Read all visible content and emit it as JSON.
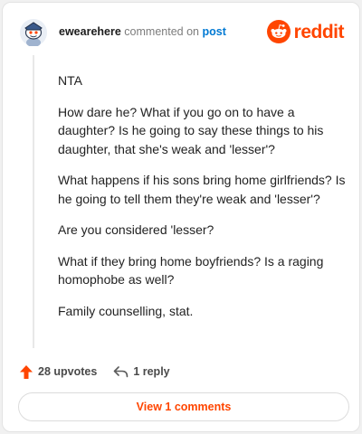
{
  "header": {
    "username": "ewearehere",
    "action_text": "commented on",
    "post_link": "post",
    "brand": "reddit"
  },
  "comment": {
    "paragraphs": [
      "NTA",
      "How dare he? What if you go on to have a daughter? Is he going to say these things to his daughter, that she's weak and 'lesser'?",
      "What happens if his sons bring home girlfriends? Is he going to tell them they're weak and 'lesser'?",
      "Are you considered 'lesser?",
      "What if they bring home boyfriends? Is a raging homophobe as well?",
      "Family counselling, stat."
    ]
  },
  "actions": {
    "upvotes": "28 upvotes",
    "reply": "1 reply",
    "upvote_icon": "arrow-up-icon",
    "reply_icon": "reply-arrow-icon"
  },
  "footer": {
    "view_comments": "View 1 comments"
  },
  "colors": {
    "brand": "#ff4500",
    "link": "#0079d3"
  }
}
